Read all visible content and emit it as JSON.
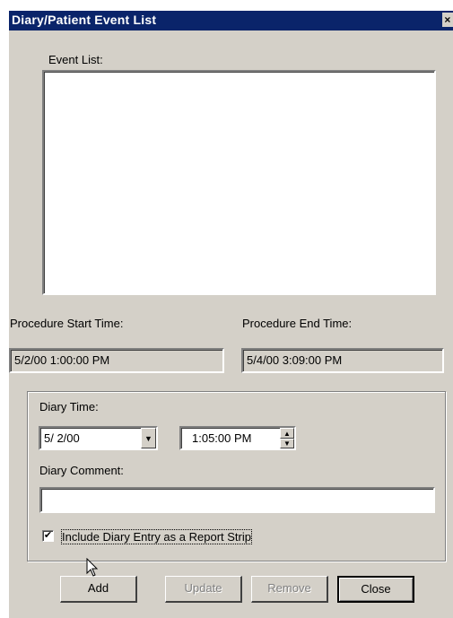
{
  "window": {
    "title": "Diary/Patient Event List",
    "close_glyph": "×"
  },
  "event_list": {
    "label": "Event List:",
    "items": []
  },
  "procedure": {
    "start_label": "Procedure Start Time:",
    "start_value": "5/2/00 1:00:00 PM",
    "end_label": "Procedure End Time:",
    "end_value": "5/4/00 3:09:00 PM"
  },
  "diary": {
    "time_label": "Diary Time:",
    "date_value": "5/ 2/00",
    "time_value": "1:05:00 PM",
    "comment_label": "Diary Comment:",
    "comment_value": "",
    "report_strip_label": "Include Diary Entry as a Report Strip",
    "report_strip_checked": true
  },
  "buttons": {
    "add": "Add",
    "update": "Update",
    "remove": "Remove",
    "close": "Close"
  },
  "icons": {
    "close": "close-icon",
    "dropdown": "chevron-down-icon",
    "spin_up": "spin-up-icon",
    "spin_down": "spin-down-icon",
    "cursor": "mouse-pointer-icon"
  }
}
